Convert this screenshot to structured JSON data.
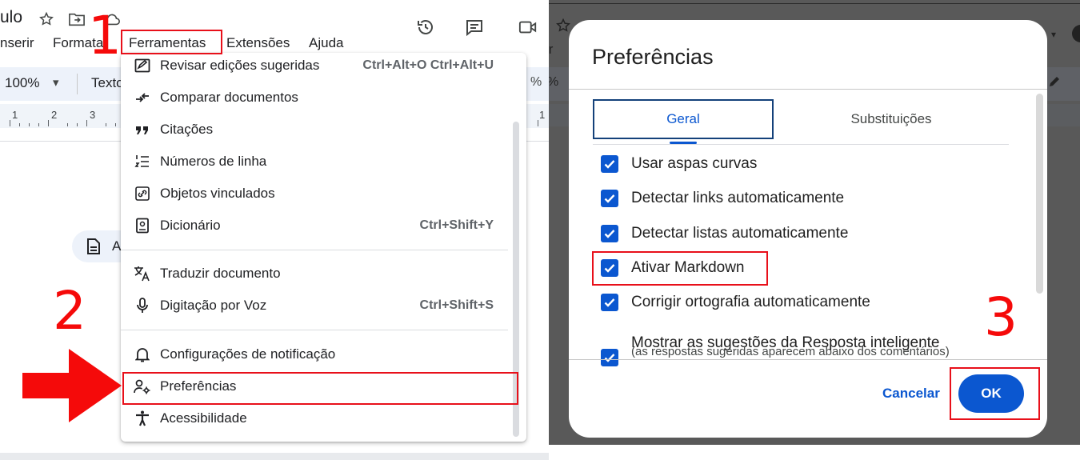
{
  "left": {
    "title_fragment": "ulo",
    "menubar": [
      "nserir",
      "Formatar",
      "Ferramentas",
      "Extensões",
      "Ajuda"
    ],
    "toolbar": {
      "zoom": "100%",
      "style": "Texto",
      "dropdown_glyph": "▾",
      "percent": "%"
    },
    "ruler_numbers": [
      "1",
      "2",
      "3",
      "1"
    ],
    "chip_text": "A",
    "menu_items": [
      {
        "icon": "review-edits-icon",
        "label": "Revisar edições sugeridas",
        "shortcut": "Ctrl+Alt+O Ctrl+Alt+U"
      },
      {
        "icon": "compare-icon",
        "label": "Comparar documentos",
        "shortcut": ""
      },
      {
        "icon": "quote-icon",
        "label": "Citações",
        "shortcut": ""
      },
      {
        "icon": "line-numbers-icon",
        "label": "Números de linha",
        "shortcut": ""
      },
      {
        "icon": "linked-objects-icon",
        "label": "Objetos vinculados",
        "shortcut": ""
      },
      {
        "icon": "dictionary-icon",
        "label": "Dicionário",
        "shortcut": "Ctrl+Shift+Y"
      },
      {
        "icon": "translate-icon",
        "label": "Traduzir documento",
        "shortcut": ""
      },
      {
        "icon": "microphone-icon",
        "label": "Digitação por Voz",
        "shortcut": "Ctrl+Shift+S"
      },
      {
        "icon": "bell-icon",
        "label": "Configurações de notificação",
        "shortcut": ""
      },
      {
        "icon": "user-settings-icon",
        "label": "Preferências",
        "shortcut": ""
      },
      {
        "icon": "accessibility-icon",
        "label": "Acessibilidade",
        "shortcut": ""
      }
    ],
    "step_labels": [
      "1",
      "2"
    ]
  },
  "right": {
    "dialog_title": "Preferências",
    "tabs": [
      "Geral",
      "Substituições"
    ],
    "options": [
      {
        "label": "Usar aspas curvas",
        "checked": true
      },
      {
        "label": "Detectar links automaticamente",
        "checked": true
      },
      {
        "label": "Detectar listas automaticamente",
        "checked": true
      },
      {
        "label": "Ativar Markdown",
        "checked": true
      },
      {
        "label": "Corrigir ortografia automaticamente",
        "checked": true
      },
      {
        "label": "Mostrar as sugestões da Resposta inteligente",
        "checked": true
      }
    ],
    "option_subtext": "(as respostas sugeridas aparecem abaixo dos comentários)",
    "cancel_label": "Cancelar",
    "ok_label": "OK",
    "step_label": "3",
    "behind_fragment": "ir"
  },
  "colors": {
    "accent": "#0b57d0",
    "highlight": "#e8101a",
    "overlay": "#595959"
  }
}
